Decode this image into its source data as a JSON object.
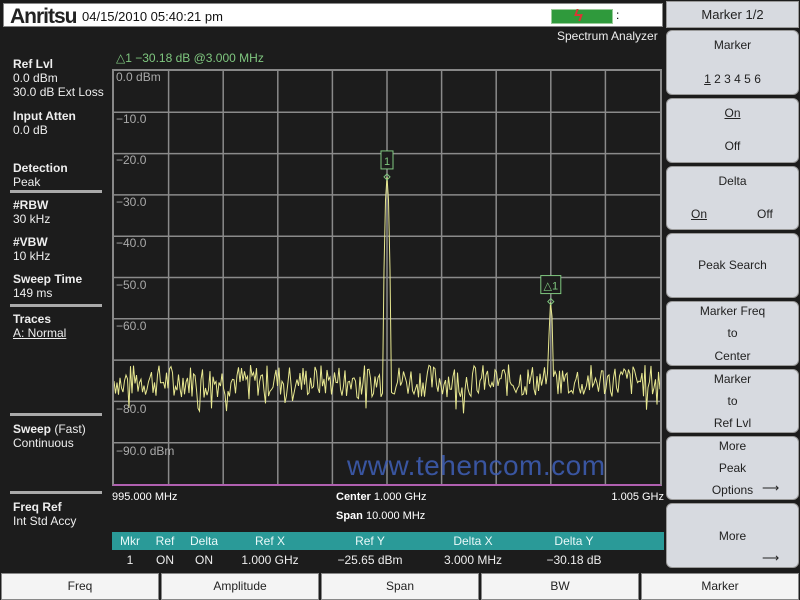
{
  "header": {
    "logo": "Anritsu",
    "datetime": "04/15/2010 05:40:21 pm",
    "mode": "Spectrum Analyzer",
    "battery_icon": "battery-charging-icon"
  },
  "left_panel": {
    "ref_lvl": {
      "label": "Ref Lvl",
      "value": "0.0 dBm",
      "ext_loss": "30.0 dB Ext Loss"
    },
    "input_atten": {
      "label": "Input Atten",
      "value": "0.0 dB"
    },
    "detection": {
      "label": "Detection",
      "value": "Peak"
    },
    "rbw": {
      "label": "#RBW",
      "value": "30 kHz"
    },
    "vbw": {
      "label": "#VBW",
      "value": "10 kHz"
    },
    "sweep_time": {
      "label": "Sweep Time",
      "value": "149 ms"
    },
    "traces": {
      "label": "Traces",
      "value": "A: Normal"
    },
    "sweep": {
      "label": "Sweep",
      "mode": "(Fast)",
      "value": "Continuous"
    },
    "freq_ref": {
      "label": "Freq Ref",
      "value": "Int Std Accy"
    }
  },
  "plot": {
    "marker_readout": "△1 −30.18 dB @3.000 MHz",
    "y_labels": [
      "0.0 dBm",
      "−10.0",
      "−20.0",
      "−30.0",
      "−40.0",
      "−50.0",
      "−60.0",
      "",
      "−80.0",
      "−90.0 dBm"
    ],
    "start_freq": "995.000 MHz",
    "stop_freq": "1.005 GHz",
    "center_label": "Center",
    "center_value": "1.000 GHz",
    "span_label": "Span",
    "span_value": "10.000 MHz",
    "trace_color": "#e8e890",
    "noise_floor_dbm": -75,
    "ref_level_dbm": 0,
    "bottom_dbm": -100,
    "markers": [
      {
        "label": "1",
        "offset_mhz": 0,
        "level_dbm": -25.65
      },
      {
        "label": "△1",
        "offset_mhz": 3.0,
        "level_dbm": -55.83
      }
    ]
  },
  "watermark": "www.tehencom.com",
  "marker_table": {
    "headers": [
      "Mkr",
      "Ref",
      "Delta",
      "Ref X",
      "Ref Y",
      "Delta X",
      "Delta Y"
    ],
    "rows": [
      [
        "1",
        "ON",
        "ON",
        "1.000 GHz",
        "−25.65 dBm",
        "3.000 MHz",
        "−30.18 dB"
      ]
    ]
  },
  "softkeys": {
    "title": "Marker 1/2",
    "marker": {
      "label": "Marker",
      "selected": "1",
      "others": "2 3 4 5 6"
    },
    "onoff": {
      "on": "On",
      "off": "Off"
    },
    "delta": {
      "label": "Delta",
      "on": "On",
      "off": "Off"
    },
    "peak_search": "Peak Search",
    "marker_freq_to_center": [
      "Marker Freq",
      "to",
      "Center"
    ],
    "marker_to_ref": [
      "Marker",
      "to",
      "Ref Lvl"
    ],
    "more_peak": [
      "More",
      "Peak",
      "Options"
    ],
    "more": "More"
  },
  "bottom_menu": [
    "Freq",
    "Amplitude",
    "Span",
    "BW",
    "Marker"
  ]
}
